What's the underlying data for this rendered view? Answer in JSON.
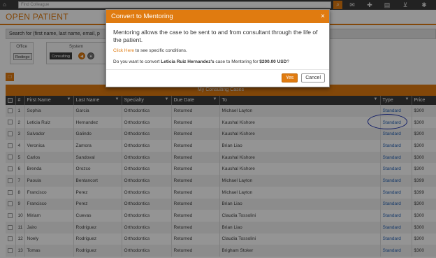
{
  "topbar": {
    "search_placeholder": "Find Colleague",
    "icons": [
      "home-icon",
      "search-icon",
      "chat-icon",
      "add-user-icon",
      "book-icon",
      "cart-icon",
      "gear-icon"
    ]
  },
  "page": {
    "title": "OPEN PATIENT",
    "search_label": "Search for (first name, last name, email, p"
  },
  "filters": {
    "office": {
      "title": "Office",
      "option": "Redingo"
    },
    "system": {
      "title": "System",
      "option": "Consulting"
    }
  },
  "table": {
    "caption": "My Consulting Cases",
    "columns": [
      "#",
      "First Name",
      "Last Name",
      "Specialty",
      "Due Date",
      "To",
      "Type",
      "Price"
    ],
    "rows": [
      {
        "n": "1",
        "first": "Sophia",
        "last": "Garcia",
        "specialty": "Orthodontics",
        "due": "Returned",
        "to": "Michael Layton",
        "type": "Standard",
        "price": "$300"
      },
      {
        "n": "2",
        "first": "Leticia Ruiz",
        "last": "Hernandez",
        "specialty": "Orthodontics",
        "due": "Returned",
        "to": "Kaushal Kishore",
        "type": "Standard",
        "price": "$300"
      },
      {
        "n": "3",
        "first": "Salvador",
        "last": "Galindo",
        "specialty": "Orthodontics",
        "due": "Returned",
        "to": "Kaushal Kishore",
        "type": "Standard",
        "price": "$300"
      },
      {
        "n": "4",
        "first": "Veronica",
        "last": "Zamora",
        "specialty": "Orthodontics",
        "due": "Returned",
        "to": "Brian Liao",
        "type": "Standard",
        "price": "$300"
      },
      {
        "n": "5",
        "first": "Carlos",
        "last": "Sandoval",
        "specialty": "Orthodontics",
        "due": "Returned",
        "to": "Kaushal Kishore",
        "type": "Standard",
        "price": "$300"
      },
      {
        "n": "6",
        "first": "Brenda",
        "last": "Orozco",
        "specialty": "Orthodontics",
        "due": "Returned",
        "to": "Kaushal Kishore",
        "type": "Standard",
        "price": "$300"
      },
      {
        "n": "7",
        "first": "Paoula",
        "last": "Bentancort",
        "specialty": "Orthodontics",
        "due": "Returned",
        "to": "Michael Layton",
        "type": "Standard",
        "price": "$399"
      },
      {
        "n": "8",
        "first": "Francisco",
        "last": "Perez",
        "specialty": "Orthodontics",
        "due": "Returned",
        "to": "Michael Layton",
        "type": "Standard",
        "price": "$399"
      },
      {
        "n": "9",
        "first": "Francisco",
        "last": "Perez",
        "specialty": "Orthodontics",
        "due": "Returned",
        "to": "Brian Liao",
        "type": "Standard",
        "price": "$300"
      },
      {
        "n": "10",
        "first": "Miriam",
        "last": "Cuevas",
        "specialty": "Orthodontics",
        "due": "Returned",
        "to": "Claudia Tossolini",
        "type": "Standard",
        "price": "$300"
      },
      {
        "n": "11",
        "first": "Jairo",
        "last": "Rodriguez",
        "specialty": "Orthodontics",
        "due": "Returned",
        "to": "Brian Liao",
        "type": "Standard",
        "price": "$300"
      },
      {
        "n": "12",
        "first": "Noely",
        "last": "Rodriguez",
        "specialty": "Orthodontics",
        "due": "Returned",
        "to": "Claudia Tossolini",
        "type": "Standard",
        "price": "$300"
      },
      {
        "n": "13",
        "first": "Tomas",
        "last": "Rodriguez",
        "specialty": "Orthodontics",
        "due": "Returned",
        "to": "Brigham Stoker",
        "type": "Standard",
        "price": "$300"
      }
    ]
  },
  "modal": {
    "title": "Convert to Mentoring",
    "close": "×",
    "text": "Mentoring allows the case to be sent to and from consultant through the life of the patient.",
    "link": "Click Here",
    "link_suffix": " to see specific conditions.",
    "q_prefix": "Do you want to convert ",
    "q_name": "Leticia Ruiz Hernandez's",
    "q_middle": " case to Mentoring for ",
    "q_price": "$200.00 USD",
    "q_suffix": "?",
    "yes": "Yes",
    "cancel": "Cancel"
  },
  "colors": {
    "accent": "#e07b10",
    "dark": "#3c3c3c",
    "link": "#2a66b8",
    "annotation": "#1a2fb0"
  }
}
